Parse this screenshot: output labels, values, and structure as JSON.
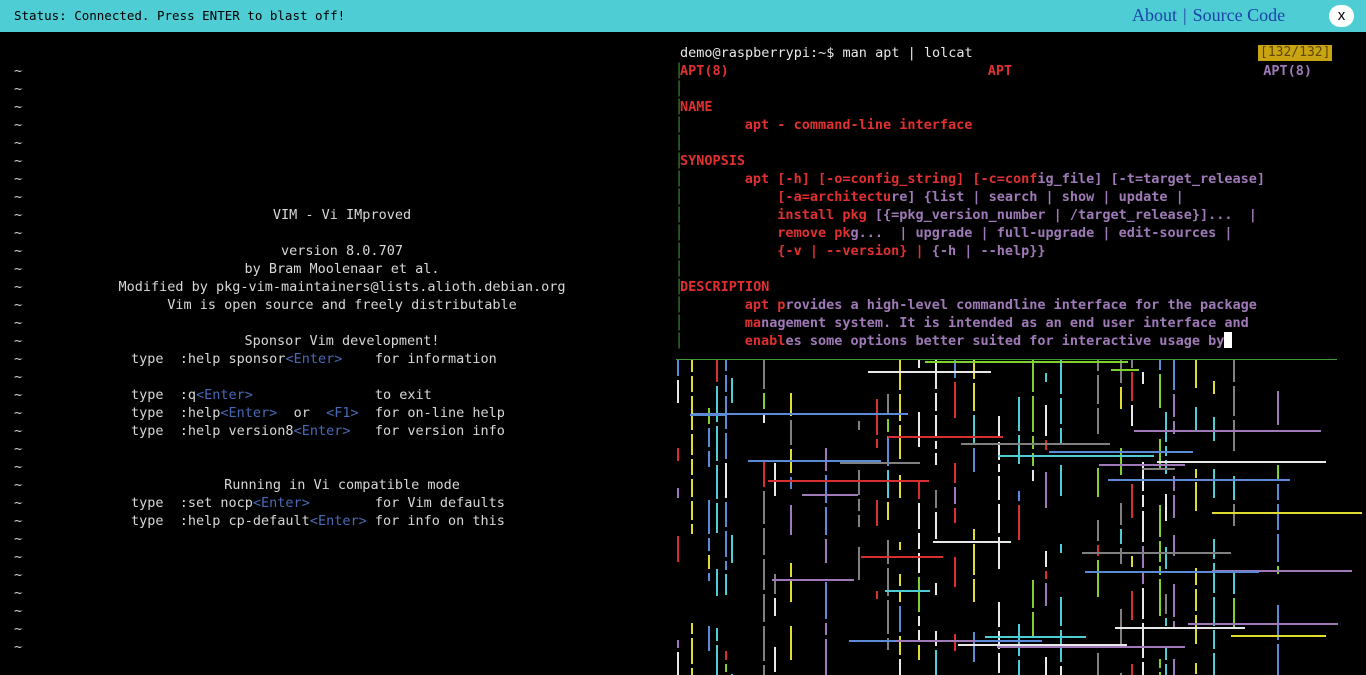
{
  "topbar": {
    "status": "Status: Connected. Press ENTER to blast off!",
    "about": "About",
    "separator": "|",
    "source_code": "Source Code",
    "close": "x"
  },
  "vim": {
    "tilde": "~",
    "title": "VIM - Vi IMproved",
    "version": "version 8.0.707",
    "author": "by Bram Moolenaar et al.",
    "modified": "Modified by pkg-vim-maintainers@lists.alioth.debian.org",
    "license": "Vim is open source and freely distributable",
    "sponsor_heading": "Sponsor Vim development!",
    "commands": [
      {
        "cmd": "type  :help sponsor",
        "key": "<Enter>",
        "pad": "    ",
        "desc": "for information"
      },
      {
        "cmd": "type  :q",
        "key": "<Enter>",
        "pad": "               ",
        "desc": "to exit"
      },
      {
        "cmd": "type  :help",
        "key": "<Enter>",
        "pad": "  or  ",
        "key2": "<F1>",
        "pad2": "  ",
        "desc": "for on-line help"
      },
      {
        "cmd": "type  :help version8",
        "key": "<Enter>",
        "pad": "   ",
        "desc": "for version info"
      }
    ],
    "compat_heading": "Running in Vi compatible mode",
    "compat_commands": [
      {
        "cmd": "type  :set nocp",
        "key": "<Enter>",
        "pad": "        ",
        "desc": "for Vim defaults"
      },
      {
        "cmd": "type  :help cp-default",
        "key": "<Enter>",
        "pad": " ",
        "desc": "for info on this"
      }
    ]
  },
  "terminal": {
    "prompt": "demo@raspberrypi:~$ man apt | lolcat",
    "counter": "[132/132]",
    "header_left": "APT(8)",
    "header_center": "APT",
    "header_right": "APT(8)",
    "name_heading": "NAME",
    "name_text": "apt - command-line interface",
    "synopsis_heading": "SYNOPSIS",
    "synopsis_lines": [
      "apt [-h] [-o=config_string] [-c=config_file] [-t=target_release]",
      "    [-a=architecture] {list | search | show | update |",
      "    install pkg [{=pkg_version_number | /target_release}]...  |",
      "    remove pkg...  | upgrade | full-upgrade | edit-sources |",
      "    {-v | --version} | {-h | --help}}"
    ],
    "description_heading": "DESCRIPTION",
    "description_lines": [
      "apt provides a high-level commandline interface for the package",
      "management system. It is intended as an end user interface and",
      "enables some options better suited for interactive usage by"
    ],
    "colors": {
      "red": "#e03030",
      "purple": "#a07ab8",
      "pink": "#c24a8a",
      "art_palette": [
        "#e8e8e8",
        "#4ecdd4",
        "#e0dc30",
        "#80d030",
        "#d83030",
        "#5a8ad8",
        "#a07ab8",
        "#808080"
      ]
    }
  }
}
